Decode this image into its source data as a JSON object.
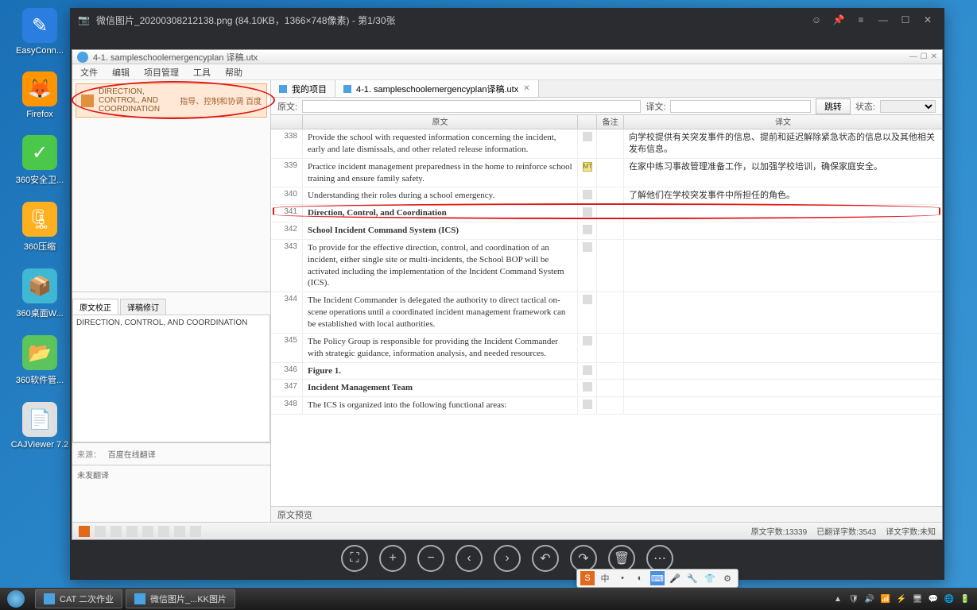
{
  "desktop": {
    "icons": [
      {
        "label": "EasyConn...",
        "cls": "ico-easy",
        "glyph": "✎"
      },
      {
        "label": "Firefox",
        "cls": "ico-firefox",
        "glyph": "🦊"
      },
      {
        "label": "360安全卫...",
        "cls": "ico-360g",
        "glyph": "✓"
      },
      {
        "label": "360压缩",
        "cls": "ico-360c",
        "glyph": "🗜"
      },
      {
        "label": "360桌面W...",
        "cls": "ico-360s",
        "glyph": "📦"
      },
      {
        "label": "360软件管...",
        "cls": "ico-360w",
        "glyph": "📂"
      },
      {
        "label": "CAJViewer 7.2",
        "cls": "ico-caj",
        "glyph": "📄"
      }
    ]
  },
  "viewer": {
    "title": "微信图片_20200308212138.png (84.10KB，1366×748像素) - 第1/30张",
    "toolbar_glyphs": {
      "fit": "⛶",
      "zoomin": "+",
      "zoomout": "−",
      "prev": "‹",
      "next": "›",
      "rotl": "↶",
      "rotr": "↷",
      "del": "🗑",
      "more": "⋯"
    }
  },
  "app": {
    "title": "4-1. sampleschoolemergencyplan 译稿.utx",
    "menu": [
      "文件",
      "编辑",
      "项目管理",
      "工具",
      "帮助"
    ],
    "sidebar": {
      "top_label": "",
      "entry_title": "DIRECTION, CONTROL, AND COORDINATION",
      "entry_sub": "指导、控制和协调  百度",
      "mid_label": "",
      "tabs": [
        "原文校正",
        "译稿修订"
      ],
      "content": "DIRECTION, CONTROL, AND COORDINATION",
      "bottom_label": "来源：",
      "bottom_value": "百度在线翻译",
      "foot": "未发翻译"
    },
    "tabs": [
      {
        "label": "我的项目",
        "active": false
      },
      {
        "label": "4-1. sampleschoolemergencyplan译稿.utx",
        "active": true,
        "closable": true
      }
    ],
    "filter": {
      "src_label": "原文:",
      "tgt_label": "译文:",
      "btn": "跳转",
      "status_label": "状态:"
    },
    "headers": {
      "src": "原文",
      "note": "备注",
      "tgt": "译文"
    },
    "rows": [
      {
        "n": "338",
        "src": "Provide the school with requested information concerning the incident, early and late dismissals, and other related release information.",
        "tgt": "向学校提供有关突发事件的信息、提前和延迟解除紧急状态的信息以及其他相关发布信息。",
        "stat": "d"
      },
      {
        "n": "339",
        "src": "Practice incident management preparedness in the home to reinforce school training and ensure family safety.",
        "tgt": "在家中练习事故管理准备工作，以加强学校培训，确保家庭安全。",
        "stat": "mt"
      },
      {
        "n": "340",
        "src": "Understanding their roles during a school emergency.",
        "tgt": "了解他们在学校突发事件中所担任的角色。",
        "stat": "d"
      },
      {
        "n": "341",
        "src": "Direction, Control, and Coordination",
        "tgt": "",
        "bold": true,
        "stat": "d",
        "hl": true
      },
      {
        "n": "342",
        "src": "School Incident Command System (ICS)",
        "tgt": "",
        "bold": true,
        "stat": "d"
      },
      {
        "n": "343",
        "src": "To provide for the effective direction, control, and coordination of an incident, either single site or multi-incidents, the School BOP will be activated including the implementation of the Incident Command System (ICS).",
        "tgt": "",
        "stat": "d"
      },
      {
        "n": "344",
        "src": "The Incident Commander is delegated the authority to direct tactical on-scene operations until a coordinated incident management framework can be established with local authorities.",
        "tgt": "",
        "stat": "d"
      },
      {
        "n": "345",
        "src": "The Policy Group is responsible for providing the Incident Commander with strategic guidance, information analysis, and needed resources.",
        "tgt": "",
        "stat": "d"
      },
      {
        "n": "346",
        "src": "Figure 1.",
        "tgt": "",
        "bold": true,
        "stat": "d"
      },
      {
        "n": "347",
        "src": "Incident Management Team",
        "tgt": "",
        "bold": true,
        "stat": "d"
      },
      {
        "n": "348",
        "src": "The ICS is organized into the following functional areas:",
        "tgt": "",
        "stat": "d"
      }
    ],
    "preview_label": "原文预览",
    "status": {
      "left_count": "原文字数:13339",
      "mid_count": "已翻译字数:3543",
      "right_count": "译文字数:未知"
    }
  },
  "taskbar": {
    "items": [
      {
        "label": "CAT 二次作业"
      },
      {
        "label": "微信图片_...KK图片"
      }
    ]
  }
}
